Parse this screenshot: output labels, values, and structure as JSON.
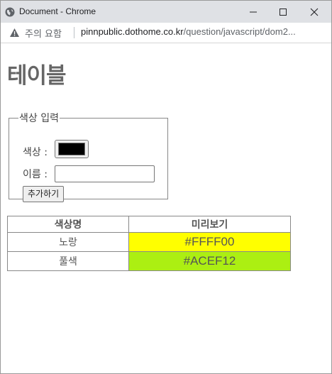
{
  "window": {
    "title": "Document - Chrome",
    "favicon": "globe-icon"
  },
  "addressbar": {
    "security_icon": "warning-triangle-icon",
    "security_label": "주의 요함",
    "url_host": "pinnpublic.dothome.co.kr",
    "url_path": "/question/javascript/dom2..."
  },
  "page": {
    "title": "테이블",
    "form": {
      "legend": "색상 입력",
      "color_label": "색상 :",
      "color_value": "#000000",
      "name_label": "이름 :",
      "name_value": "",
      "submit_label": "추가하기"
    },
    "table": {
      "headers": [
        "색상명",
        "미리보기"
      ],
      "rows": [
        {
          "name": "노랑",
          "hex": "#FFFF00",
          "color": "#FFFF00"
        },
        {
          "name": "풀색",
          "hex": "#ACEF12",
          "color": "#ACEF12"
        }
      ]
    }
  }
}
